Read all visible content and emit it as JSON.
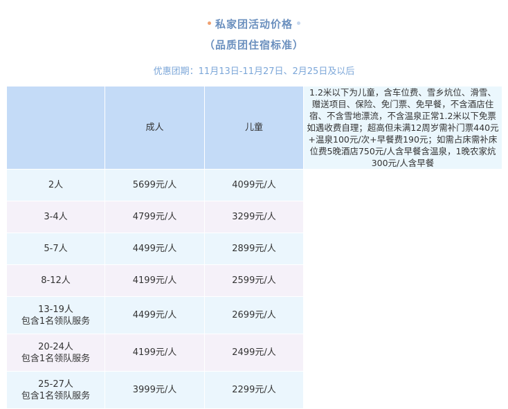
{
  "header": {
    "title": "私家团活动价格",
    "subtitle": "（品质团住宿标准）",
    "period": "优惠团期：11月13日-11月27日、2月25日及以后"
  },
  "table": {
    "columns": [
      "",
      "成人",
      "儿童"
    ],
    "rows": [
      {
        "group": "2人",
        "extra": "",
        "adult": "5699元/人",
        "child": "4099元/人"
      },
      {
        "group": "3-4人",
        "extra": "",
        "adult": "4799元/人",
        "child": "3299元/人"
      },
      {
        "group": "5-7人",
        "extra": "",
        "adult": "4499元/人",
        "child": "2899元/人"
      },
      {
        "group": "8-12人",
        "extra": "",
        "adult": "4199元/人",
        "child": "2599元/人"
      },
      {
        "group": "13-19人",
        "extra": "包含1名领队服务",
        "adult": "4499元/人",
        "child": "2699元/人"
      },
      {
        "group": "20-24人",
        "extra": "包含1名领队服务",
        "adult": "4199元/人",
        "child": "2499元/人"
      },
      {
        "group": "25-27人",
        "extra": "包含1名领队服务",
        "adult": "3999元/人",
        "child": "2299元/人"
      }
    ],
    "note": "1.2米以下为儿童，含车位费、雪乡炕位、滑雪、赠送项目、保险、免门票、免早餐，不含酒店住宿、不含雪地漂流，不含温泉正常1.2米以下免票如遇收费自理；超高但未满12周岁需补门票440元+温泉100元/次+早餐费190元；如需占床需补床位费5晚酒店750元/人含早餐含温泉，1晚农家炕300元/人含早餐"
  },
  "colors": {
    "title": "#6a8fbe",
    "header_bg": "#c4dbf7",
    "row_blue": "#ebf6fd",
    "row_lilac": "#f5f1f9"
  }
}
